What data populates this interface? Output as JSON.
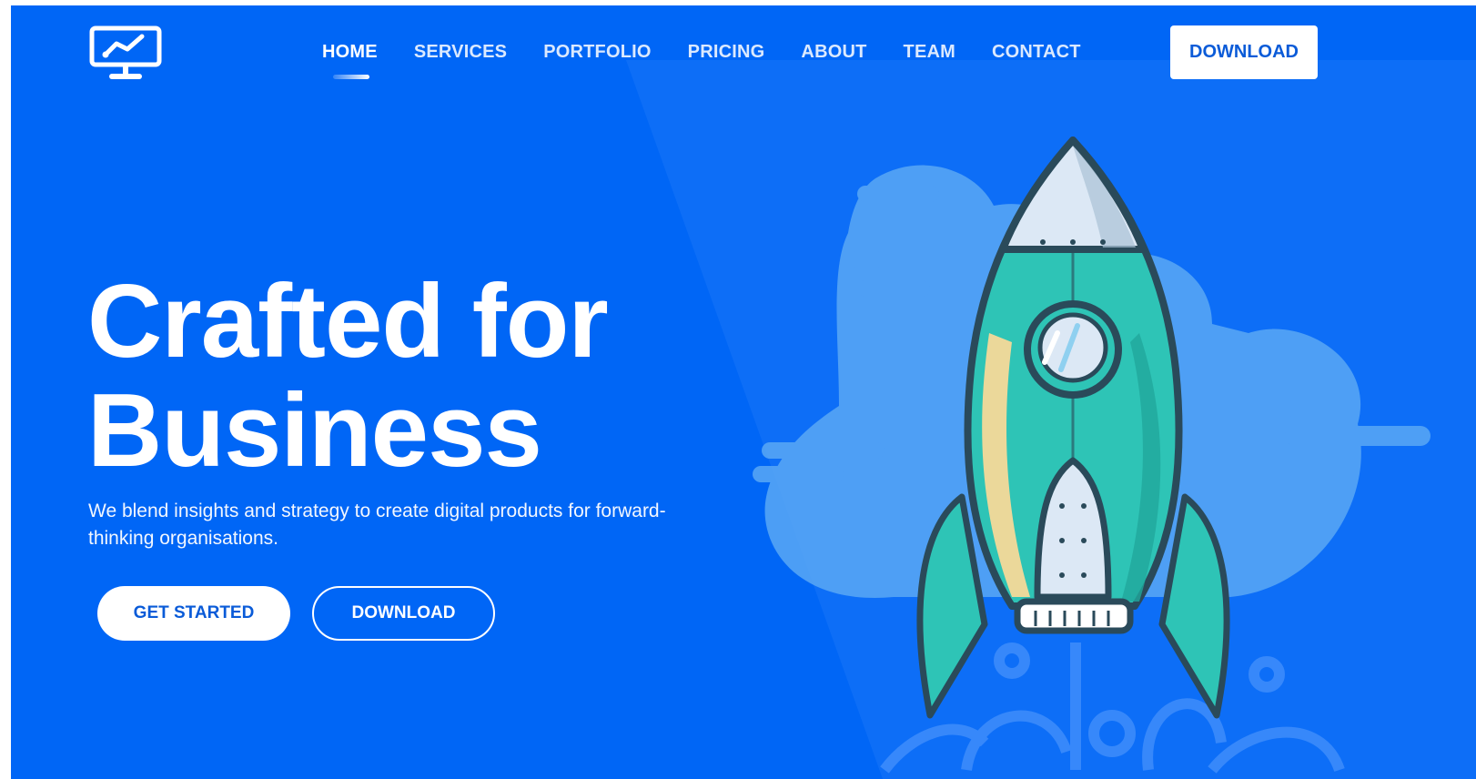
{
  "brand": {
    "logo_icon": "monitor-chart-icon"
  },
  "nav": {
    "items": [
      {
        "label": "HOME",
        "active": true
      },
      {
        "label": "SERVICES"
      },
      {
        "label": "PORTFOLIO"
      },
      {
        "label": "PRICING"
      },
      {
        "label": "ABOUT"
      },
      {
        "label": "TEAM"
      },
      {
        "label": "CONTACT"
      }
    ],
    "download_label": "DOWNLOAD"
  },
  "hero": {
    "title_line1": "Crafted for",
    "title_line2": "Business",
    "subtitle": "We blend insights and strategy to create digital products for forward-thinking organisations.",
    "primary_button": "GET STARTED",
    "secondary_button": "DOWNLOAD",
    "illustration_icon": "rocket-illustration"
  },
  "colors": {
    "background": "#0066f6",
    "accent_text": "#0a5bd8",
    "rocket_body": "#2ec4b6",
    "rocket_outline": "#2a4a5a",
    "cloud": "#5aa8f5"
  }
}
